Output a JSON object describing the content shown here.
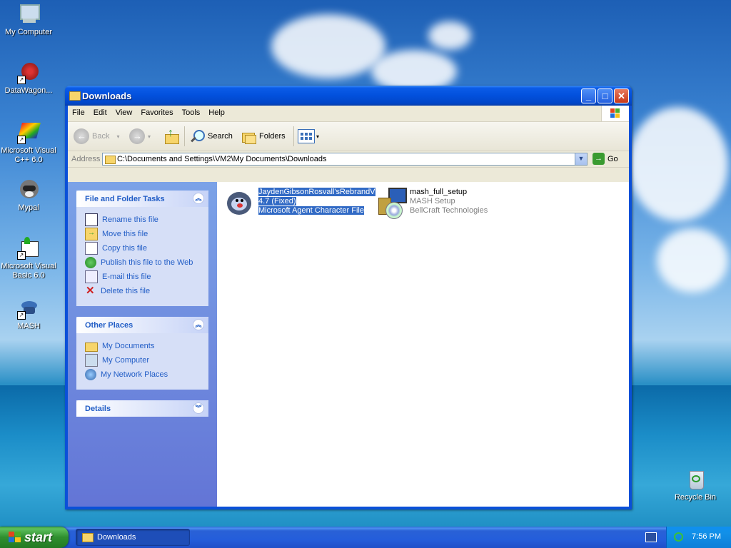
{
  "desktop": {
    "icons": [
      {
        "label": "My Computer"
      },
      {
        "label": "DataWagon..."
      },
      {
        "label": "Microsoft Visual C++ 6.0"
      },
      {
        "label": "Mypal"
      },
      {
        "label": "Microsoft Visual Basic 6.0"
      },
      {
        "label": "MASH"
      },
      {
        "label": "Recycle Bin"
      }
    ]
  },
  "window": {
    "title": "Downloads",
    "menu": [
      "File",
      "Edit",
      "View",
      "Favorites",
      "Tools",
      "Help"
    ],
    "toolbar": {
      "back": "Back",
      "search": "Search",
      "folders": "Folders"
    },
    "address": {
      "label": "Address",
      "value": "C:\\Documents and Settings\\VM2\\My Documents\\Downloads",
      "go": "Go"
    },
    "tasks": {
      "title": "File and Folder Tasks",
      "items": [
        "Rename this file",
        "Move this file",
        "Copy this file",
        "Publish this file to the Web",
        "E-mail this file",
        "Delete this file"
      ]
    },
    "places": {
      "title": "Other Places",
      "items": [
        "My Documents",
        "My Computer",
        "My Network Places"
      ]
    },
    "details": {
      "title": "Details"
    },
    "files": [
      {
        "name": "JaydenGibsonRosvall'sRebrandV",
        "line2": "4.7 (Fixed)",
        "line3": "Microsoft Agent Character File",
        "selected": true
      },
      {
        "name": "mash_full_setup",
        "line2": "MASH Setup",
        "line3": "BellCraft Technologies",
        "selected": false
      }
    ]
  },
  "taskbar": {
    "start": "start",
    "task": "Downloads",
    "clock": "7:56 PM"
  },
  "colors": {
    "titlebar": "#0250dc",
    "link": "#215dc6",
    "selection": "#316ac5",
    "start": "#2f8f2f"
  }
}
